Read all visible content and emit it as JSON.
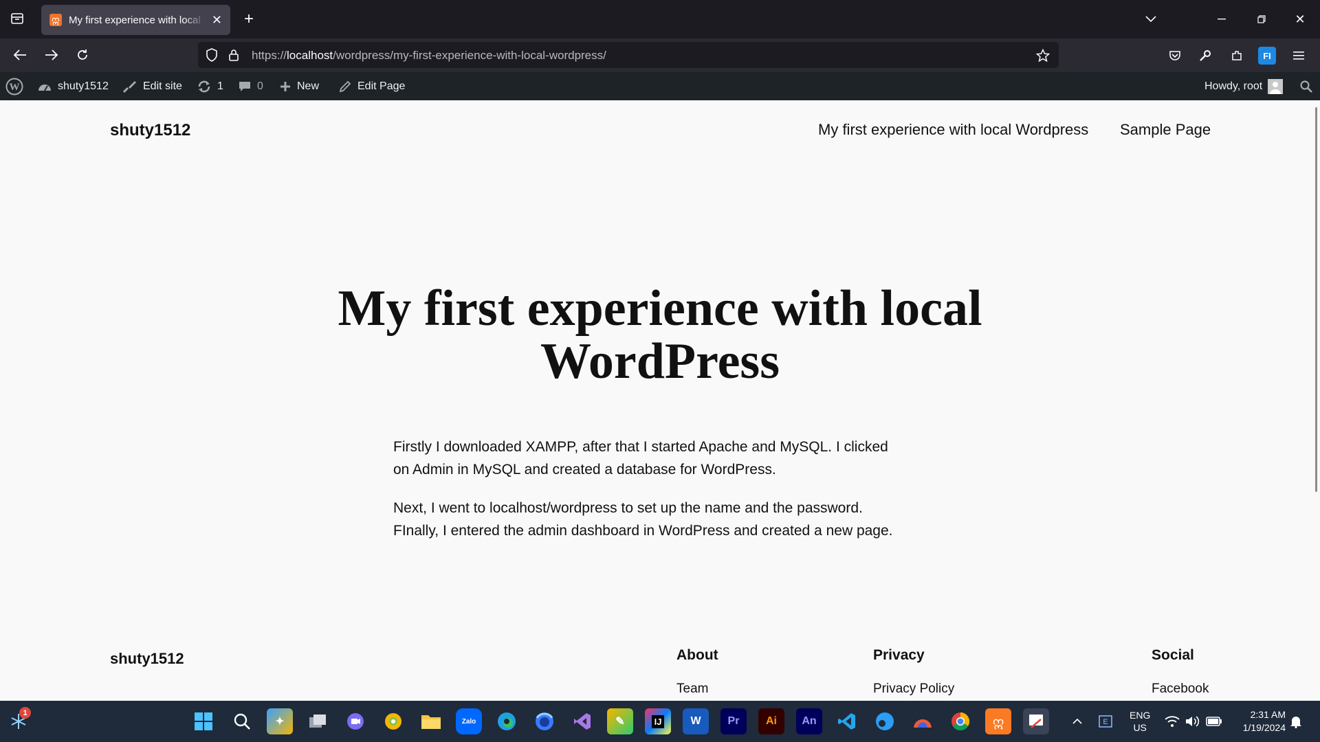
{
  "browser": {
    "tab_title": "My first experience with local WordPress",
    "url_scheme": "https://",
    "url_host": "localhost",
    "url_path": "/wordpress/my-first-experience-with-local-wordpress/"
  },
  "wp_admin_bar": {
    "site_name": "shuty1512",
    "edit_site": "Edit site",
    "updates_count": "1",
    "comments_count": "0",
    "new_label": "New",
    "edit_page": "Edit Page",
    "howdy": "Howdy, root"
  },
  "site": {
    "title": "shuty1512",
    "nav": [
      "My first experience with local Wordpress",
      "Sample Page"
    ]
  },
  "article": {
    "heading": "My first experience with local WordPress",
    "paragraph1_line1": "Firstly I downloaded XAMPP, after that I started Apache and MySQL. I clicked",
    "paragraph1_line2": "on Admin in MySQL and created a database for WordPress.",
    "paragraph2_line1": "Next, I went to localhost/wordpress to set up the name and the password.",
    "paragraph2_line2": "FInally, I entered the admin dashboard in WordPress and created a new page."
  },
  "footer": {
    "title": "shuty1512",
    "about_heading": "About",
    "about_item": "Team",
    "privacy_heading": "Privacy",
    "privacy_item": "Privacy Policy",
    "social_heading": "Social",
    "social_item": "Facebook"
  },
  "taskbar": {
    "weather_badge": "1",
    "lang_top": "ENG",
    "lang_bottom": "US",
    "time": "2:31 AM",
    "date": "1/19/2024",
    "apps": [
      "start-icon",
      "search-icon",
      "copilot-pre-icon",
      "task-view-icon",
      "meet-icon",
      "chrome-canary-icon",
      "file-explorer-icon",
      "zalo-icon",
      "edge-icon",
      "firefox-icon",
      "visual-studio-icon",
      "sketch-icon",
      "intellij-icon",
      "word-icon",
      "premiere-icon",
      "illustrator-icon",
      "animate-icon",
      "vscode-icon",
      "edge-legacy-icon",
      "copilot-icon",
      "chrome-icon",
      "xampp-icon",
      "snipping-tool-icon"
    ]
  }
}
